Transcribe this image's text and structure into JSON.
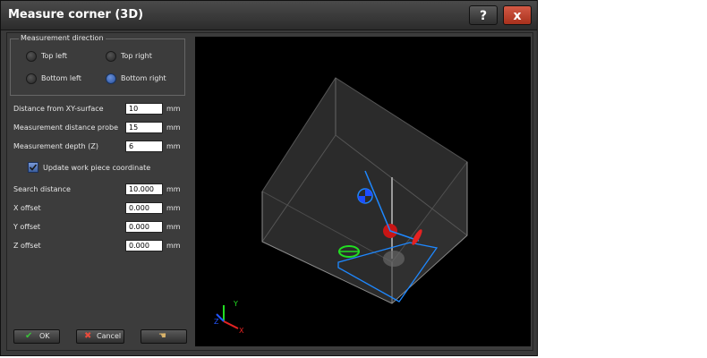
{
  "window": {
    "title": "Measure corner (3D)",
    "help_label": "?",
    "close_label": "x"
  },
  "direction": {
    "group_label": "Measurement direction",
    "options": [
      {
        "label": "Top left",
        "checked": false
      },
      {
        "label": "Top right",
        "checked": false
      },
      {
        "label": "Bottom left",
        "checked": false
      },
      {
        "label": "Bottom right",
        "checked": true
      }
    ]
  },
  "fields": [
    {
      "label": "Distance from XY-surface",
      "value": "10",
      "unit": "mm"
    },
    {
      "label": "Measurement distance probe",
      "value": "15",
      "unit": "mm"
    },
    {
      "label": "Measurement depth (Z)",
      "value": "6",
      "unit": "mm"
    }
  ],
  "update_checkbox": {
    "label": "Update work piece coordinate",
    "checked": true
  },
  "fields2": [
    {
      "label": "Search distance",
      "value": "10.000",
      "unit": "mm"
    },
    {
      "label": "X offset",
      "value": "0.000",
      "unit": "mm"
    },
    {
      "label": "Y offset",
      "value": "0.000",
      "unit": "mm"
    },
    {
      "label": "Z offset",
      "value": "0.000",
      "unit": "mm"
    }
  ],
  "axes": {
    "x": "X",
    "y": "Y",
    "z": "Z"
  },
  "buttons": {
    "ok_label": "OK",
    "cancel_label": "Cancel"
  },
  "colors": {
    "accent_blue": "#1e88ff",
    "probe_red": "#d01818",
    "marker_green": "#22dd22",
    "close_red": "#c0432e"
  }
}
